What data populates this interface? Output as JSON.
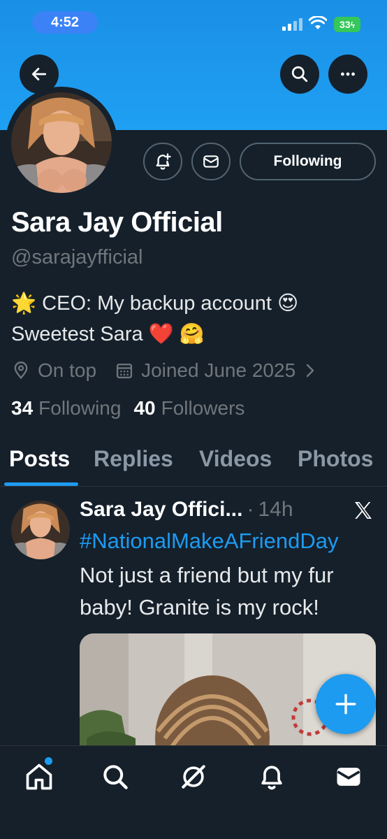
{
  "status_bar": {
    "time": "4:52",
    "battery": "33"
  },
  "profile": {
    "name": "Sara Jay Official",
    "handle": "@sarajayfficial",
    "bio_line1": "🌟 CEO: My backup account 😍",
    "bio_line2": "Sweetest Sara ❤️ 🤗",
    "location": "On top",
    "joined": "Joined June 2025",
    "following_count": "34",
    "following_label": "Following",
    "followers_count": "40",
    "followers_label": "Followers",
    "follow_button": "Following"
  },
  "tabs": [
    "Posts",
    "Replies",
    "Videos",
    "Photos"
  ],
  "post": {
    "author": "Sara Jay Offici...",
    "dot": "·",
    "time": "14h",
    "hashtag": "#NationalMakeAFriendDay",
    "text": "Not just a friend but my fur baby!  Granite is my rock!"
  },
  "colors": {
    "accent": "#1d9bf0",
    "background": "#15202b",
    "banner": "#1da1f2",
    "muted": "#71767b"
  },
  "icons": {
    "back": "arrow-left-icon",
    "search": "search-icon",
    "more": "more-icon",
    "notify": "bell-plus-icon",
    "message": "envelope-icon",
    "location": "location-pin-icon",
    "calendar": "calendar-icon",
    "chevron": "chevron-right-icon",
    "x": "x-logo-icon",
    "compose": "plus-icon",
    "nav": [
      "home-icon",
      "search-icon",
      "grok-icon",
      "bell-icon",
      "mail-icon"
    ]
  }
}
